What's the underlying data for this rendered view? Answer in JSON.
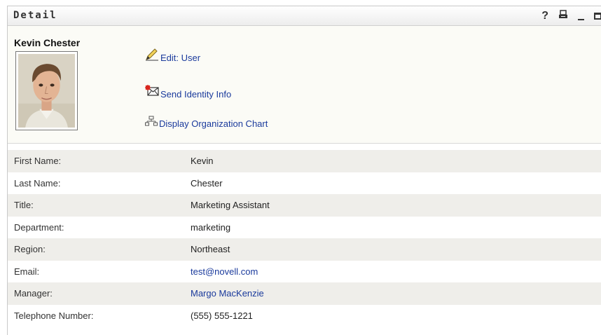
{
  "portlet": {
    "title": "Detail",
    "help_label": "?"
  },
  "header": {
    "user_name": "Kevin Chester",
    "actions": [
      {
        "label": "Edit: User",
        "icon": "pencil-icon"
      },
      {
        "label": "Send Identity Info",
        "icon": "envelope-icon"
      },
      {
        "label": "Display Organization Chart",
        "icon": "org-chart-icon"
      }
    ]
  },
  "attributes": [
    {
      "label": "First Name:",
      "value": "Kevin"
    },
    {
      "label": "Last Name:",
      "value": "Chester"
    },
    {
      "label": "Title:",
      "value": "Marketing Assistant"
    },
    {
      "label": "Department:",
      "value": "marketing"
    },
    {
      "label": "Region:",
      "value": "Northeast"
    },
    {
      "label": "Email:",
      "value": "test@novell.com",
      "link": true
    },
    {
      "label": "Manager:",
      "value": "Margo MacKenzie",
      "link": true
    },
    {
      "label": "Telephone Number:",
      "value": "(555) 555-1221"
    }
  ],
  "colors": {
    "link": "#1a3a9c",
    "row_alt": "#efeeea",
    "header_bg": "#fbfbf6"
  }
}
